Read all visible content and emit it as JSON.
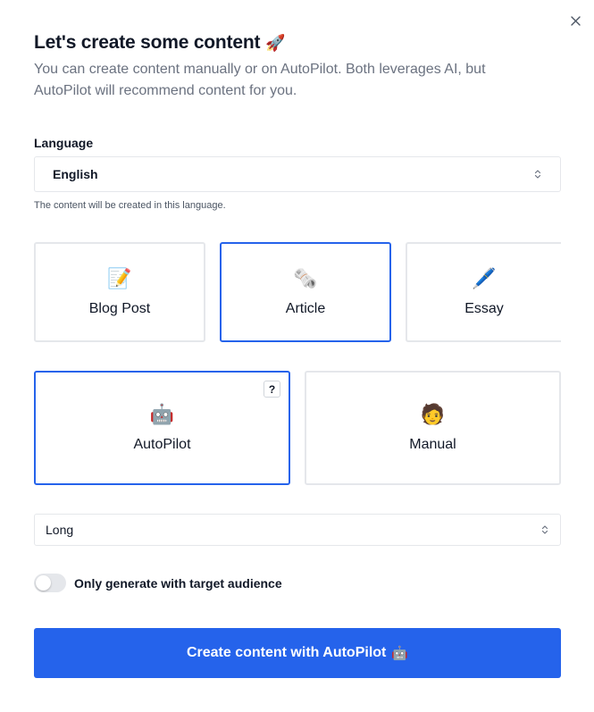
{
  "dialog": {
    "close_icon": "close-icon",
    "title": "Let's create some content",
    "title_emoji": "🚀",
    "subtitle": "You can create content manually or on AutoPilot. Both leverages AI, but AutoPilot will recommend content for you."
  },
  "language": {
    "label": "Language",
    "selected": "English",
    "helper": "The content will be created in this language."
  },
  "content_types": [
    {
      "label": "Blog Post",
      "icon": "📝",
      "icon_name": "memo-icon",
      "selected": false
    },
    {
      "label": "Article",
      "icon": "🗞️",
      "icon_name": "rolled-newspaper-icon",
      "selected": true
    },
    {
      "label": "Essay",
      "icon": "🖊️",
      "icon_name": "pen-icon",
      "selected": false
    }
  ],
  "modes": [
    {
      "label": "AutoPilot",
      "icon": "🤖",
      "icon_name": "robot-icon",
      "selected": true
    },
    {
      "label": "Manual",
      "icon": "🧑",
      "icon_name": "person-icon",
      "selected": false
    }
  ],
  "help_badge": "?",
  "length": {
    "selected": "Long"
  },
  "audience_toggle": {
    "label": "Only generate with target audience",
    "on": false
  },
  "submit": {
    "label": "Create content with AutoPilot",
    "emoji": "🤖"
  },
  "colors": {
    "accent": "#2563eb",
    "border": "#e5e7eb",
    "muted_text": "#6b7280"
  }
}
